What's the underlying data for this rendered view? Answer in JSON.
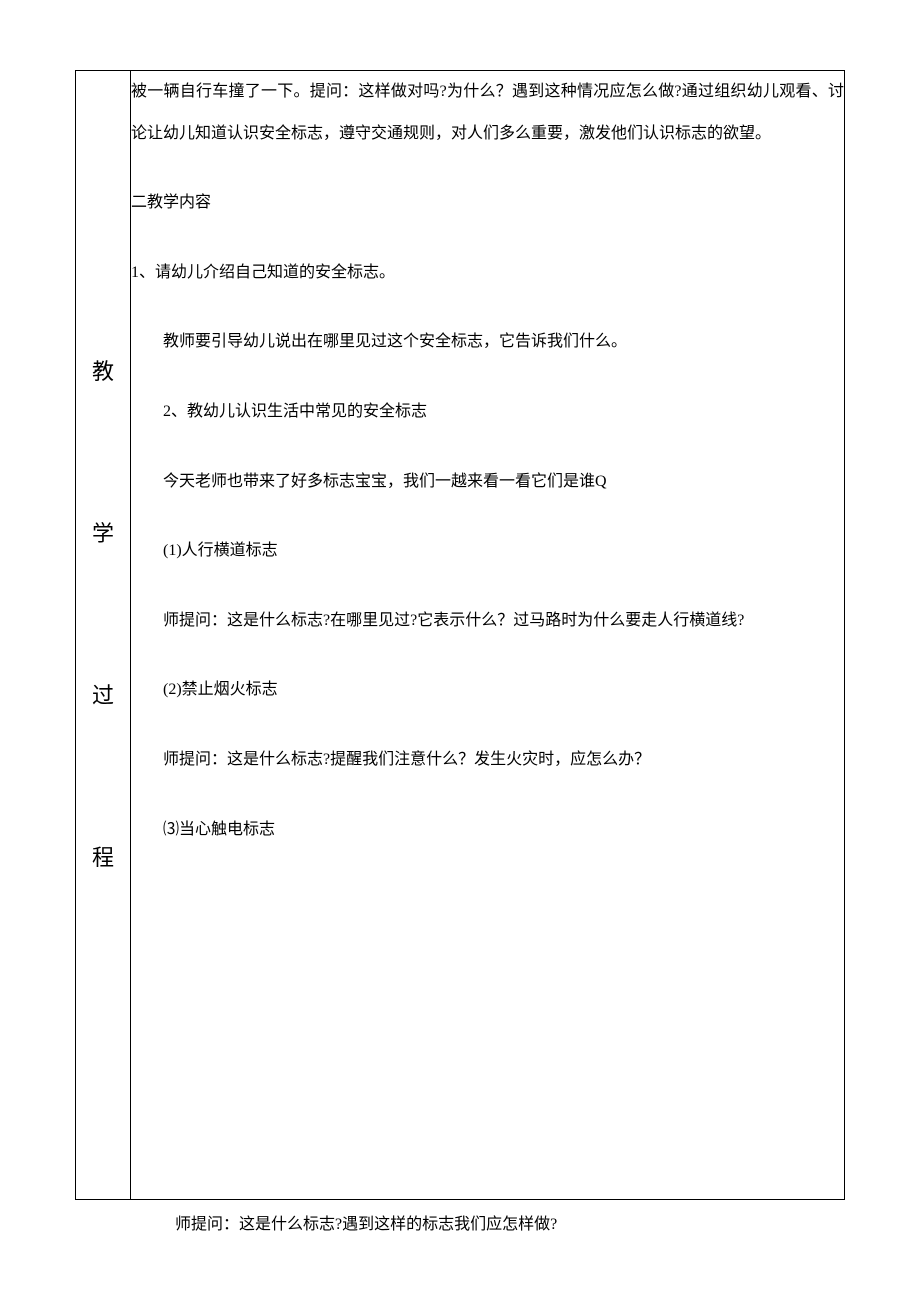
{
  "sidebar": {
    "c1": "教",
    "c2": "学",
    "c3": "过",
    "c4": "程"
  },
  "content": {
    "p1": "被一辆自行车撞了一下。提问：这样做对吗?为什么？遇到这种情况应怎么做?通过组织幼儿观看、讨论让幼儿知道认识安全标志，遵守交通规则，对人们多么重要，激发他们认识标志的欲望。",
    "p2": "二教学内容",
    "p3": "1、请幼儿介绍自己知道的安全标志。",
    "p4": "教师要引导幼儿说出在哪里见过这个安全标志，它告诉我们什么。",
    "p5": "2、教幼儿认识生活中常见的安全标志",
    "p6": "今天老师也带来了好多标志宝宝，我们一越来看一看它们是谁Q",
    "p7": "(1)人行横道标志",
    "p8": "师提问：这是什么标志?在哪里见过?它表示什么？过马路时为什么要走人行横道线?",
    "p9": "(2)禁止烟火标志",
    "p10": "师提问：这是什么标志?提醒我们注意什么？发生火灾时，应怎么办？",
    "p11": "⑶当心触电标志"
  },
  "below": "师提问：这是什么标志?遇到这样的标志我们应怎样做?"
}
